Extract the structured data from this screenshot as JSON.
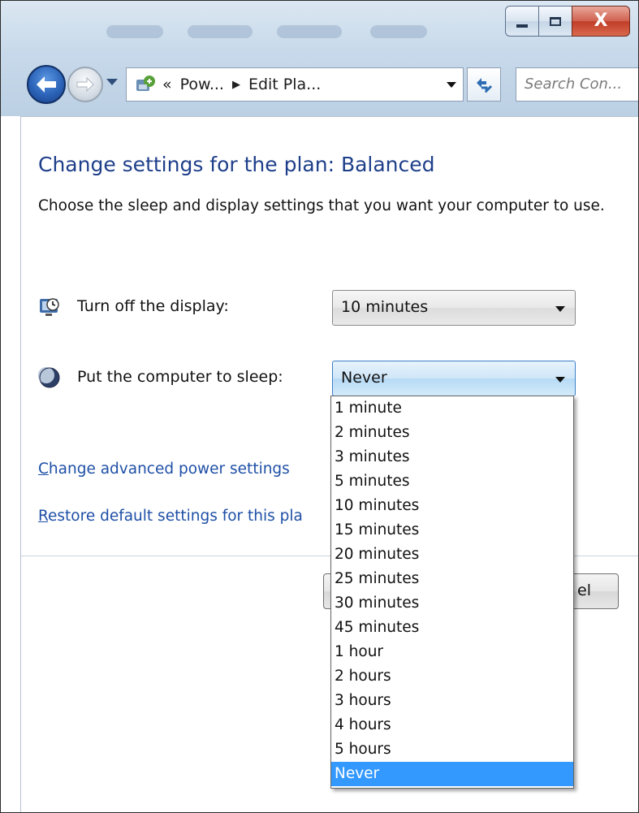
{
  "window": {
    "caption_buttons": {
      "minimize_icon": "minimize-icon",
      "maximize_icon": "maximize-icon",
      "close_label": "X"
    }
  },
  "nav": {
    "back_icon": "back-arrow-icon",
    "forward_icon": "forward-arrow-icon",
    "address_parts": [
      "«",
      "Pow...",
      "Edit Pla..."
    ],
    "refresh_icon": "refresh-icon",
    "search_placeholder": "Search Con..."
  },
  "content": {
    "heading": "Change settings for the plan: Balanced",
    "description": "Choose the sleep and display settings that you want your computer to use.",
    "display": {
      "label": "Turn off the display:",
      "value": "10 minutes",
      "icon": "display-timer-icon"
    },
    "sleep": {
      "label": "Put the computer to sleep:",
      "value": "Never",
      "icon": "sleep-moon-icon"
    },
    "links": {
      "advanced_first": "C",
      "advanced_rest": "hange advanced power settings",
      "restore_first": "R",
      "restore_rest": "estore default settings for this pla"
    },
    "buttons_behind": {
      "cancel_partial": "el"
    }
  },
  "dropdown": {
    "options": [
      "1 minute",
      "2 minutes",
      "3 minutes",
      "5 minutes",
      "10 minutes",
      "15 minutes",
      "20 minutes",
      "25 minutes",
      "30 minutes",
      "45 minutes",
      "1 hour",
      "2 hours",
      "3 hours",
      "4 hours",
      "5 hours",
      "Never"
    ],
    "selected": "Never"
  },
  "colors": {
    "heading": "#1e3f8a",
    "link": "#1e4fa6",
    "selection": "#3399ff",
    "close_button": "#c13c28"
  }
}
